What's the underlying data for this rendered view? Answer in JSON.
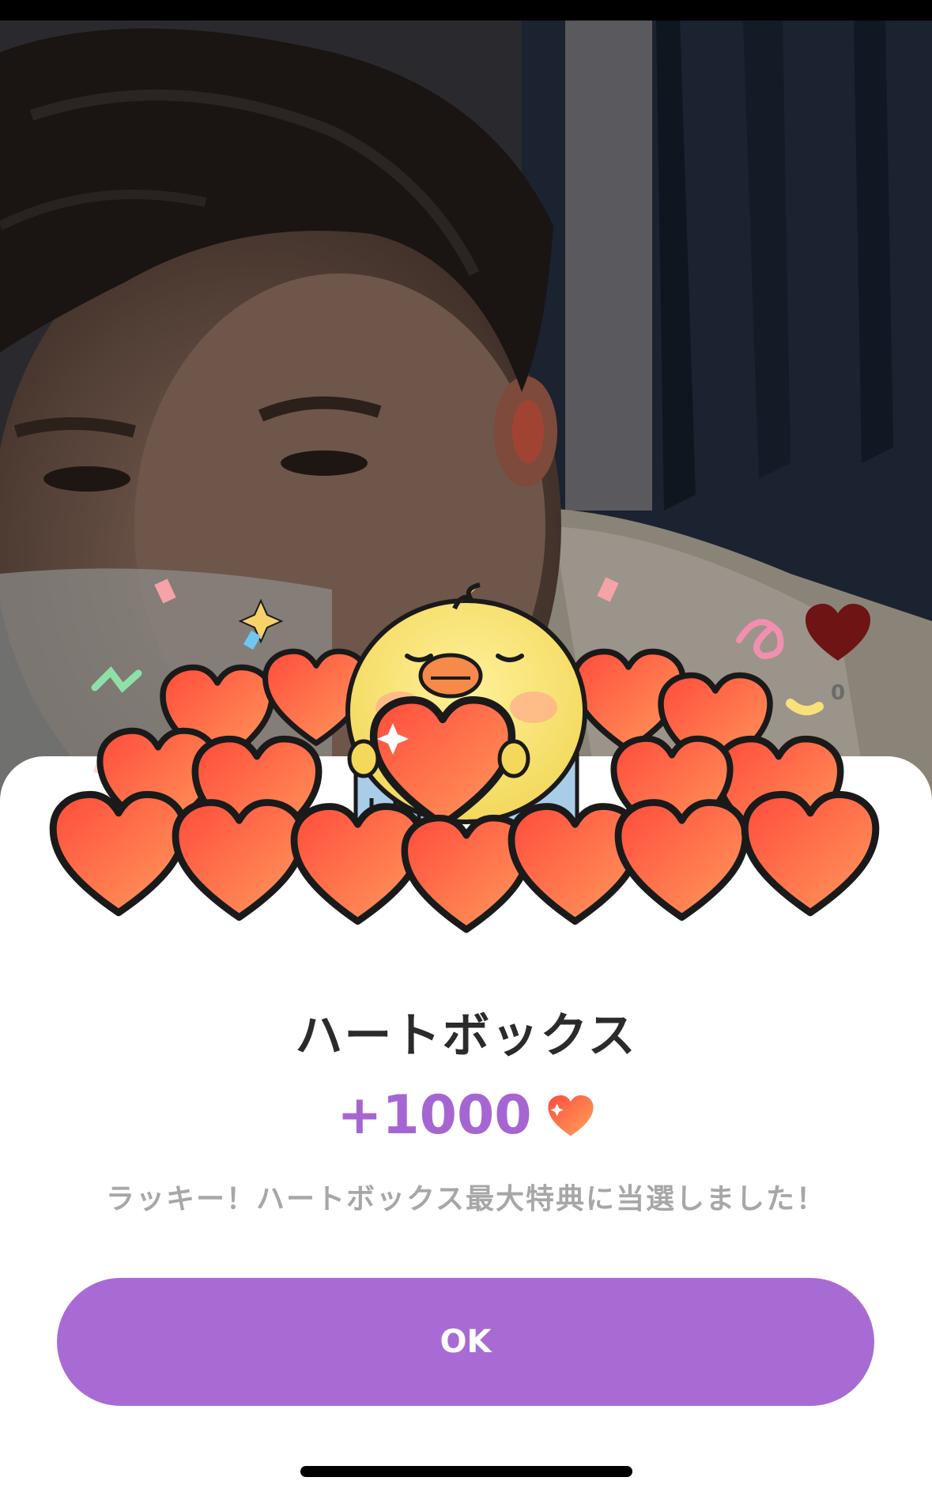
{
  "video": {
    "like_icon": "heart-icon",
    "like_count": "0"
  },
  "popup": {
    "title": "ハートボックス",
    "reward_amount": "+1000",
    "reward_icon": "heart-icon",
    "message": "ラッキー！ハートボックス最大特典に当選しました！",
    "ok_label": "OK",
    "accent_color": "#a86bd3"
  }
}
